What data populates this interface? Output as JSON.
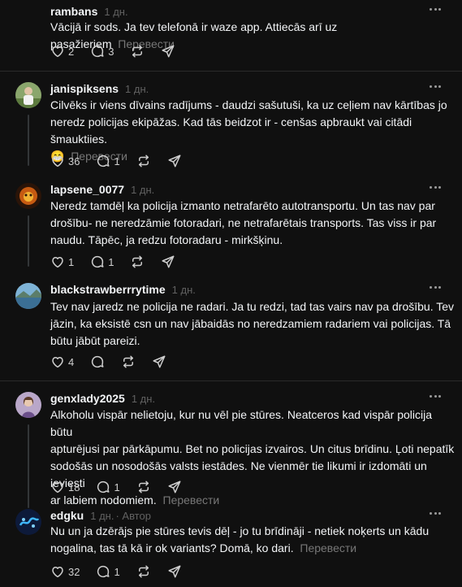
{
  "posts": [
    {
      "username": "rambans",
      "time": "1 дн.",
      "lines": [
        "Vācijā ir sods. Ja tev telefonā ir waze app. Attiecās arī uz pasažieriem"
      ],
      "translate": "Перевести",
      "likes": "2",
      "replies": "3"
    },
    {
      "username": "janispiksens",
      "time": "1 дн.",
      "lines": [
        "Cilvēks ir viens dīvains radījums - daudzi sašutuši, ka uz ceļiem nav kārtības jo",
        "neredz policijas ekipāžas. Kad tās beidzot ir - cenšas apbraukt vai citādi šmauktiies.",
        "😁"
      ],
      "translate": "Перевести",
      "likes": "36",
      "replies": "1"
    },
    {
      "username": "lapsene_0077",
      "time": "1 дн.",
      "lines": [
        "Neredz tamdēļ ka policija izmanto netrafarēto autotransportu. Un tas nav par",
        "drošību- ne neredzāmie fotoradari, ne netrafarētais transports. Tas viss ir par",
        "naudu. Tāpēc, ja redzu fotoradaru - mirkšķinu."
      ],
      "translate": "",
      "likes": "1",
      "replies": "1"
    },
    {
      "username": "blackstrawberrrytime",
      "time": "1 дн.",
      "lines": [
        "Tev nav jaredz ne policija ne radari. Ja tu redzi, tad tas vairs nav pa drošību. Tev",
        "jāzin, ka eksistē csn un nav jābaidās no neredzamiem radariem vai policijas. Tā",
        "būtu jābūt pareizi."
      ],
      "translate": "",
      "likes": "4",
      "replies": ""
    },
    {
      "username": "genxlady2025",
      "time": "1 дн.",
      "lines": [
        "Alkoholu vispār nelietoju, kur nu vēl pie stūres. Neatceros kad vispār policija būtu",
        "apturējusi par pārkāpumu. Bet no policijas izvairos. Un citus brīdinu. Ļoti nepatīk",
        "sodošās un nosodošās valsts iestādes. Ne vienmēr tie likumi ir izdomāti un ieviesti",
        "ar labiem nodomiem."
      ],
      "translate": "Перевести",
      "likes": "18",
      "replies": "1"
    },
    {
      "username": "edgku",
      "time": "1 дн.",
      "author": "· Автор",
      "lines": [
        "Nu un ja dzērājs pie stūres tevis dēļ - jo tu brīdināji - netiek noķerts un kādu",
        "nogalina, tas tā kā ir ok variants? Domā, ko dari."
      ],
      "translate": "Перевести",
      "likes": "32",
      "replies": "1"
    }
  ],
  "colors": {
    "background": "#101010",
    "text": "#f3f5f7",
    "muted": "#777777"
  },
  "icons": [
    "heart-icon",
    "reply-icon",
    "repost-icon",
    "share-icon",
    "more-icon"
  ]
}
